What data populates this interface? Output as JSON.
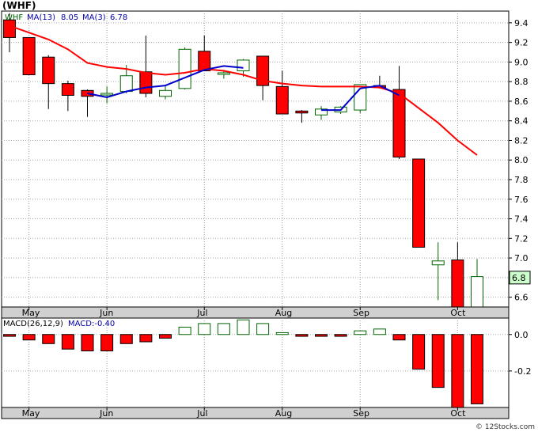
{
  "title": "(WHF)",
  "credit": "© 12Stocks.com",
  "colors": {
    "up_fill": "#ffffff",
    "up_stroke": "#006400",
    "down_fill": "#ff0000",
    "down_stroke": "#660000",
    "ma13": "#ff0000",
    "ma3": "#0000cc",
    "macd_up": "#006400",
    "macd_down": "#cc0000",
    "last_badge_bg": "#ccffcc"
  },
  "chart_data": [
    {
      "type": "candlestick",
      "legend": {
        "symbol": "WHF",
        "ma13_label": "MA(13)",
        "ma13_value": "8.05",
        "ma3_label": "MA(3)",
        "ma3_value": "6.78"
      },
      "x_labels": [
        "May",
        "Jun",
        "Jul",
        "Aug",
        "Sep",
        "Oct"
      ],
      "y_ticks": [
        "9.4",
        "9.2",
        "9.0",
        "8.8",
        "8.6",
        "8.4",
        "8.2",
        "8.0",
        "7.8",
        "7.6",
        "7.4",
        "7.2",
        "7.0",
        "6.8",
        "6.6"
      ],
      "ylim": [
        6.5,
        9.52
      ],
      "last_price": "6.8",
      "candles": [
        {
          "o": 9.43,
          "c": 9.25,
          "h": 9.5,
          "l": 9.1
        },
        {
          "o": 9.25,
          "c": 8.87,
          "h": 9.25,
          "l": 8.87
        },
        {
          "o": 9.05,
          "c": 8.78,
          "h": 9.07,
          "l": 8.52
        },
        {
          "o": 8.78,
          "c": 8.66,
          "h": 8.81,
          "l": 8.5
        },
        {
          "o": 8.71,
          "c": 8.65,
          "h": 8.72,
          "l": 8.44
        },
        {
          "o": 8.67,
          "c": 8.68,
          "h": 8.75,
          "l": 8.58
        },
        {
          "o": 8.7,
          "c": 8.86,
          "h": 8.97,
          "l": 8.68
        },
        {
          "o": 8.9,
          "c": 8.68,
          "h": 9.27,
          "l": 8.64
        },
        {
          "o": 8.65,
          "c": 8.71,
          "h": 8.76,
          "l": 8.62
        },
        {
          "o": 8.73,
          "c": 9.13,
          "h": 9.15,
          "l": 8.72
        },
        {
          "o": 9.11,
          "c": 8.91,
          "h": 9.27,
          "l": 8.91
        },
        {
          "o": 8.88,
          "c": 8.89,
          "h": 8.92,
          "l": 8.83
        },
        {
          "o": 8.91,
          "c": 9.02,
          "h": 9.03,
          "l": 8.85
        },
        {
          "o": 9.06,
          "c": 8.76,
          "h": 9.06,
          "l": 8.61
        },
        {
          "o": 8.75,
          "c": 8.47,
          "h": 8.91,
          "l": 8.47
        },
        {
          "o": 8.5,
          "c": 8.48,
          "h": 8.51,
          "l": 8.38
        },
        {
          "o": 8.46,
          "c": 8.52,
          "h": 8.55,
          "l": 8.41
        },
        {
          "o": 8.49,
          "c": 8.54,
          "h": 8.55,
          "l": 8.47
        },
        {
          "o": 8.51,
          "c": 8.77,
          "h": 8.77,
          "l": 8.48
        },
        {
          "o": 8.76,
          "c": 8.74,
          "h": 8.86,
          "l": 8.73
        },
        {
          "o": 8.72,
          "c": 8.03,
          "h": 8.96,
          "l": 8.01
        },
        {
          "o": 8.01,
          "c": 7.11,
          "h": 8.01,
          "l": 7.11
        },
        {
          "o": 6.93,
          "c": 6.97,
          "h": 7.16,
          "l": 6.57
        },
        {
          "o": 6.98,
          "c": 6.5,
          "h": 7.16,
          "l": 6.5
        },
        {
          "o": 6.5,
          "c": 6.81,
          "h": 6.99,
          "l": 6.5
        }
      ],
      "ma13": [
        9.37,
        9.3,
        9.23,
        9.13,
        8.99,
        8.95,
        8.93,
        8.89,
        8.87,
        8.89,
        8.93,
        8.91,
        8.87,
        8.81,
        8.78,
        8.76,
        8.75,
        8.75,
        8.75,
        8.74,
        8.68,
        8.53,
        8.38,
        8.2,
        8.05
      ],
      "ma3": [
        null,
        null,
        null,
        null,
        8.68,
        8.64,
        8.7,
        8.74,
        8.76,
        8.84,
        8.92,
        8.96,
        8.94,
        null,
        null,
        null,
        8.51,
        8.51,
        8.73,
        8.76,
        8.66
      ]
    },
    {
      "type": "bar",
      "legend": {
        "label": "MACD(26,12,9)",
        "value_label": "MACD:-0.40"
      },
      "y_ticks": [
        "0.0",
        "-0.2"
      ],
      "ylim": [
        -0.4,
        0.09
      ],
      "values": [
        -0.01,
        -0.03,
        -0.05,
        -0.08,
        -0.09,
        -0.09,
        -0.05,
        -0.04,
        -0.02,
        0.04,
        0.06,
        0.06,
        0.08,
        0.06,
        0.01,
        -0.01,
        -0.01,
        -0.01,
        0.02,
        0.03,
        -0.03,
        -0.19,
        -0.29,
        -0.4,
        -0.38
      ]
    }
  ]
}
